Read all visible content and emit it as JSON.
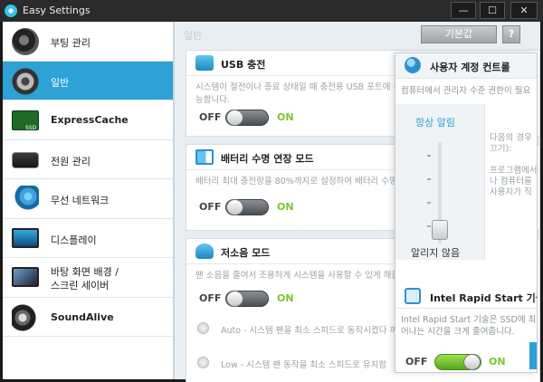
{
  "window": {
    "title": "Easy Settings",
    "minimize": "—",
    "maximize": "☐",
    "close": "✕"
  },
  "sidebar": {
    "items": [
      {
        "label": "부팅 관리",
        "icon": "boot-disc-icon"
      },
      {
        "label": "일반",
        "icon": "gear-icon",
        "active": true
      },
      {
        "label": "ExpressCache",
        "icon": "ssd-icon",
        "tag": "SSD"
      },
      {
        "label": "전원 관리",
        "icon": "battery-icon"
      },
      {
        "label": "무선 네트워크",
        "icon": "wireless-icon"
      },
      {
        "label": "디스플레이",
        "icon": "monitor-icon"
      },
      {
        "label_line1": "바탕 화면 배경 /",
        "label_line2": "스크린 세이버",
        "icon": "wallpaper-icon"
      },
      {
        "label": "SoundAlive",
        "icon": "speaker-icon"
      }
    ]
  },
  "header": {
    "section": "일반",
    "default_button": "기본값",
    "help_button": "?"
  },
  "cards": {
    "usb": {
      "title": "USB 충전",
      "desc": "시스템이 절전이나 종료 상태일 때 충전용 USB 포트에 전",
      "desc2": "능합니다.",
      "off": "OFF",
      "on": "ON",
      "enabled": false
    },
    "battery": {
      "title": "배터리 수명 연장 모드",
      "desc": "배터리 최대 충전량을 80%까지로 설정하여 배터리 수명",
      "off": "OFF",
      "on": "ON",
      "enabled": false
    },
    "quiet": {
      "title": "저소음 모드",
      "desc": "팬 소음을 줄여서 조용하게 시스템을 사용할 수 있게 해줍",
      "off": "OFF",
      "on": "ON",
      "enabled": false,
      "options": [
        "Auto - 시스템 팬을 최소 스피드로 동작시켰다 꺼줍",
        "Low - 시스템 팬 동작을 최소 스피드로 유지함"
      ]
    }
  },
  "uac_panel": {
    "title": "사용자 계정 컨트롤",
    "desc": "컴퓨터에서 관리자 수준 권한이 필요",
    "slider_top": "항상 알림",
    "slider_bottom": "알리지 않음",
    "level": 0,
    "side_text": [
      "다음의 경우",
      "끄기):",
      "",
      "프로그램에서",
      "나 컴퓨터를",
      "사용자가 직"
    ]
  },
  "rst_panel": {
    "title": "Intel Rapid Start 기술",
    "desc_line1": "Intel Rapid Start 기술은 SSD에 최대",
    "desc_line2": "어나는 시간을 크게 줄여줍니다.",
    "off": "OFF",
    "on": "ON",
    "enabled": true
  },
  "colors": {
    "accent": "#2ea1d6",
    "on_green": "#7cc62c"
  }
}
